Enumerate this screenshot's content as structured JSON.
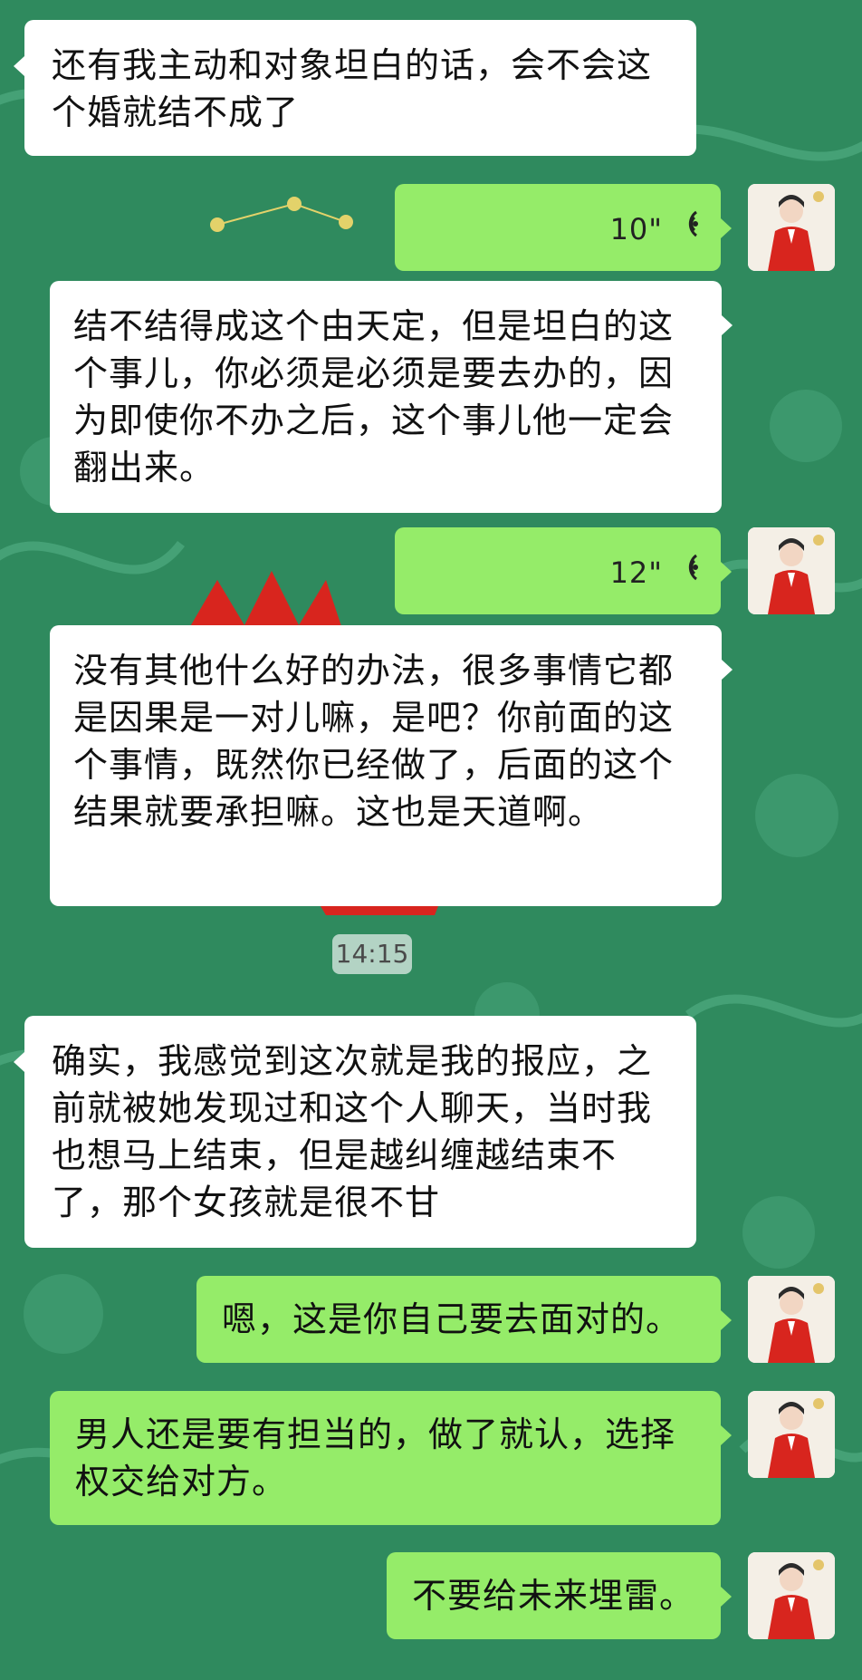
{
  "colors": {
    "background": "#2f8a5e",
    "incoming_bubble": "#ffffff",
    "outgoing_bubble": "#95ec69"
  },
  "messages": [
    {
      "type": "text",
      "side": "left",
      "text": "还有我主动和对象坦白的话，会不会这个婚就结不成了"
    },
    {
      "type": "voice",
      "side": "right",
      "duration": "10\""
    },
    {
      "type": "text",
      "side": "right",
      "text": "结不结得成这个由天定，但是坦白的这个事儿，你必须是必须是要去办的，因为即使你不办之后，这个事儿他一定会翻出来。"
    },
    {
      "type": "voice",
      "side": "right",
      "duration": "12\""
    },
    {
      "type": "text",
      "side": "right",
      "text": "没有其他什么好的办法，很多事情它都是因果是一对儿嘛，是吧？你前面的这个事情，既然你已经做了，后面的这个结果就要承担嘛。这也是天道啊。"
    },
    {
      "type": "text",
      "side": "left",
      "text": "确实，我感觉到这次就是我的报应，之前就被她发现过和这个人聊天，当时我也想马上结束，但是越纠缠越结束不了，那个女孩就是很不甘"
    },
    {
      "type": "text",
      "side": "right",
      "text": "嗯，这是你自己要去面对的。"
    },
    {
      "type": "text",
      "side": "right",
      "text": "男人还是要有担当的，做了就认，选择权交给对方。"
    },
    {
      "type": "text",
      "side": "right",
      "text": "不要给未来埋雷。"
    }
  ],
  "timestamp": "14:15"
}
